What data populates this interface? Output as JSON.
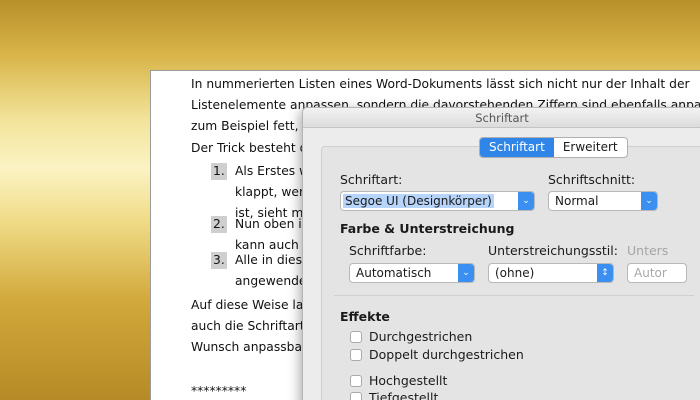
{
  "document": {
    "para1": [
      "In nummerierten Listen eines Word-Dokuments lässt sich nicht nur der Inhalt der",
      "Listenelemente anpassen, sondern die davorstehenden Ziffern sind ebenfalls anpassbar",
      "zum Beispiel fett, kur"
    ],
    "para2": "Der Trick besteht dar",
    "list": [
      {
        "num": "1.",
        "lines": [
          "Als Erstes wir",
          "klappt, wenn",
          "ist, sieht man"
        ]
      },
      {
        "num": "2.",
        "lines": [
          "Nun oben im",
          "kann auch au"
        ]
      },
      {
        "num": "3.",
        "lines": [
          "Alle in dieser",
          "angewendet,"
        ]
      }
    ],
    "para3": [
      "Auf diese Weise lasse",
      "auch die Schriftart ka",
      "Wunsch anpassbar."
    ],
    "stars": "*********"
  },
  "dialog": {
    "title": "Schriftart",
    "tabs": [
      {
        "label": "Schriftart",
        "active": true
      },
      {
        "label": "Erweitert",
        "active": false
      }
    ],
    "font_label": "Schriftart:",
    "font_value": "Segoe UI (Designkörper)",
    "style_label": "Schriftschnitt:",
    "style_value": "Normal",
    "color_section": "Farbe & Unterstreichung",
    "color_label": "Schriftfarbe:",
    "color_value": "Automatisch",
    "underline_style_label": "Unterstreichungsstil:",
    "underline_style_value": "(ohne)",
    "underline_color_label": "Unters",
    "underline_color_value": "Autor",
    "effects_section": "Effekte",
    "effects": [
      {
        "label": "Durchgestrichen",
        "checked": false
      },
      {
        "label": "Doppelt durchgestrichen",
        "checked": false
      },
      {
        "label": "Hochgestellt",
        "checked": false
      },
      {
        "label": "Tiefgestellt",
        "checked": false
      }
    ],
    "accent_color": "#2f86e8"
  }
}
